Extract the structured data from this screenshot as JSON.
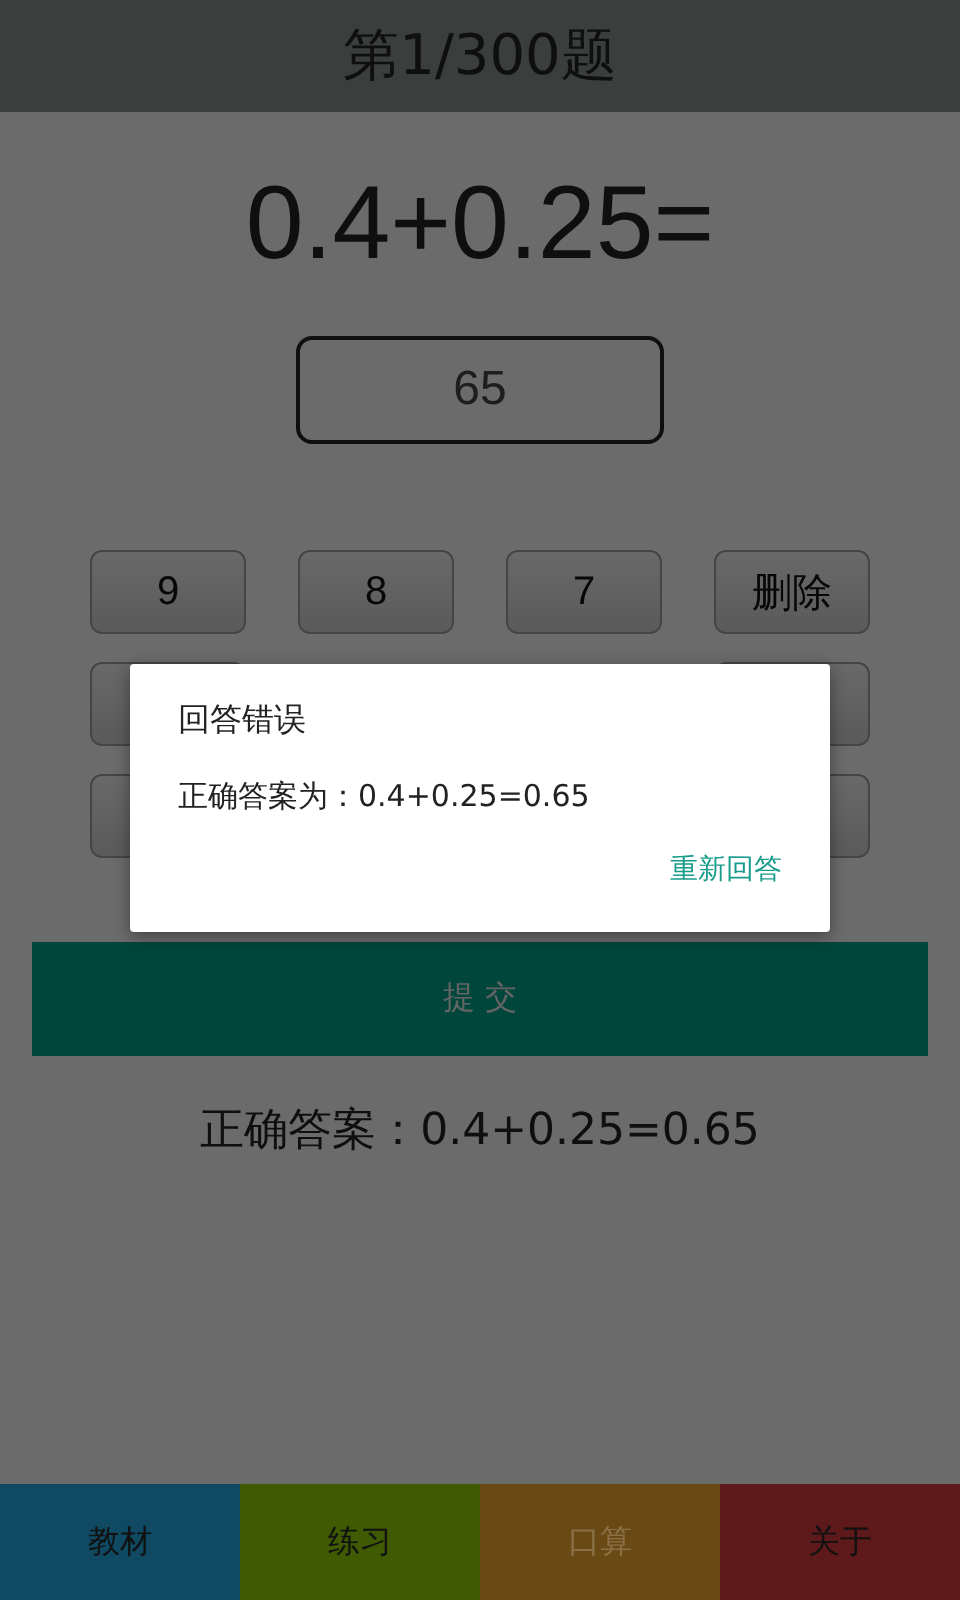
{
  "header": {
    "title": "第1/300题"
  },
  "question": "0.4+0.25=",
  "answer": {
    "value": "65"
  },
  "keypad": {
    "keys": [
      "9",
      "8",
      "7",
      "删除"
    ]
  },
  "submit": "提 交",
  "result": "正确答案：0.4+0.25=0.65",
  "tabs": [
    {
      "label": "教材",
      "color": "#0f4a62",
      "selected": false
    },
    {
      "label": "练习",
      "color": "#3f5a00",
      "selected": false
    },
    {
      "label": "口算",
      "color": "#6a4a14",
      "selected": true
    },
    {
      "label": "关于",
      "color": "#5e1a1a",
      "selected": false
    }
  ],
  "dialog": {
    "title": "回答错误",
    "message": "正确答案为：0.4+0.25=0.65",
    "action": "重新回答"
  }
}
